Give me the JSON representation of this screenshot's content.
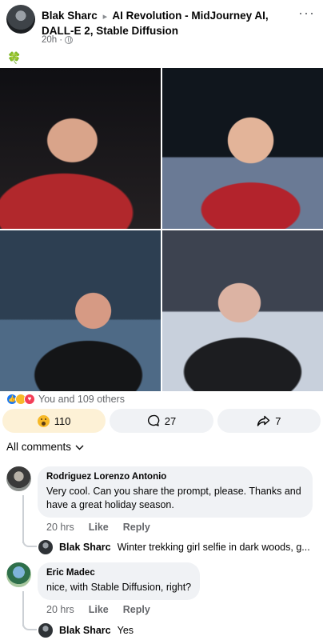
{
  "post": {
    "author": "Blak Sharc",
    "group": "AI Revolution - MidJourney AI, DALL-E 2, Stable Diffusion",
    "time": "20h",
    "separator": "·",
    "arrow": "▸",
    "more_label": "···",
    "body_emoji": "🍀"
  },
  "photos": [
    {
      "alt_icon": "photo-icon"
    },
    {
      "alt_icon": "photo-icon"
    },
    {
      "alt_icon": "photo-icon"
    },
    {
      "alt_icon": "photo-icon"
    }
  ],
  "reactions": {
    "summary": "You and 109 others",
    "icons": [
      "like-icon",
      "wow-icon",
      "love-icon"
    ]
  },
  "actions": {
    "reaction_count": "110",
    "comment_count": "27",
    "share_count": "7"
  },
  "comments_header": {
    "label": "All comments"
  },
  "comments": [
    {
      "author": "Rodriguez Lorenzo Antonio",
      "text": "Very cool. Can you share the prompt, please. Thanks and have a great holiday season.",
      "time": "20 hrs",
      "like": "Like",
      "reply": "Reply",
      "reply_preview": {
        "author": "Blak Sharc",
        "text": "Winter trekking girl selfie in dark woods, g..."
      }
    },
    {
      "author": "Eric Madec",
      "text": "nice, with Stable Diffusion, right?",
      "time": "20 hrs",
      "like": "Like",
      "reply": "Reply",
      "reply_preview": {
        "author": "Blak Sharc",
        "text": "Yes"
      }
    }
  ],
  "colors": {
    "accent_like": "#1877f2",
    "wow": "#f7b928",
    "love": "#f33e58",
    "muted_text": "#65676b",
    "bubble_bg": "#f0f2f5",
    "active_pill": "#fdf1d6"
  }
}
